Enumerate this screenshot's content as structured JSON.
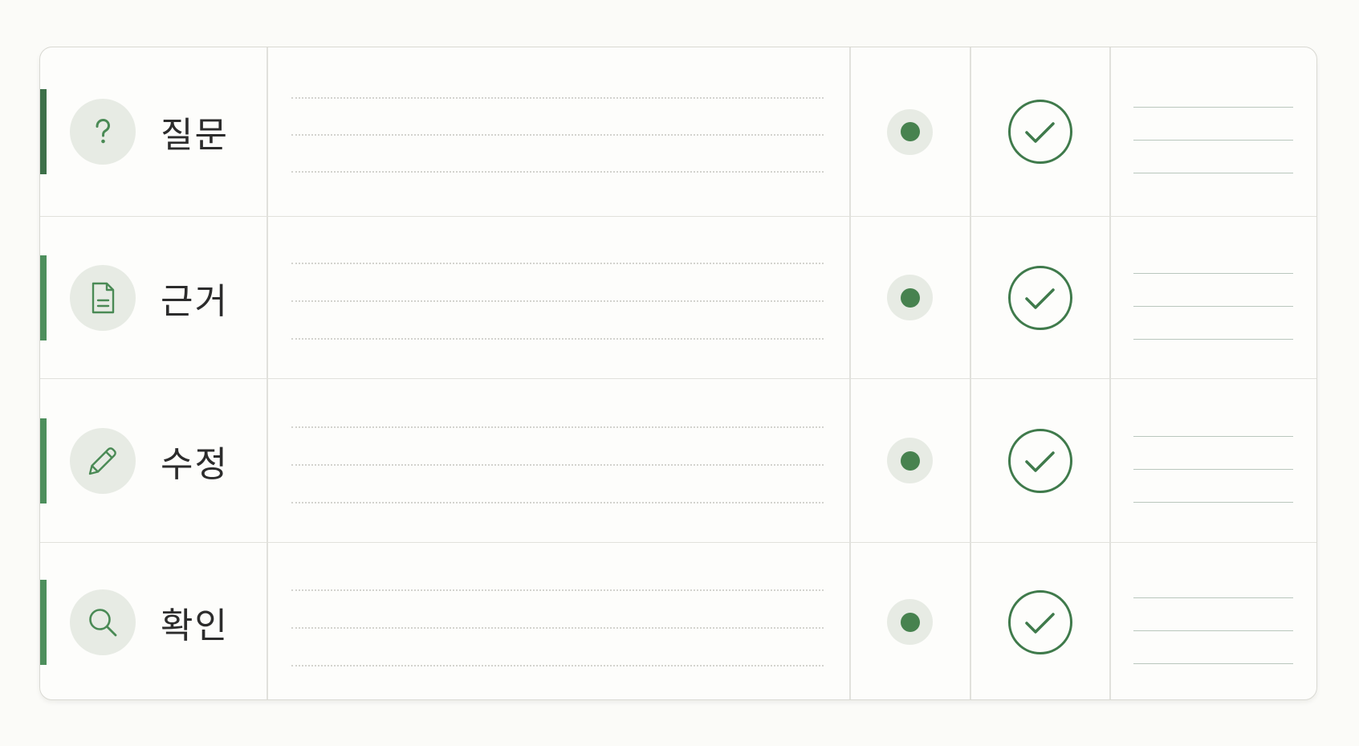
{
  "colors": {
    "accent": "#3e7a4c",
    "icon_green": "#4a8a55",
    "status_dot": "#47824f",
    "soft_bg": "#e7ebe4"
  },
  "rows": [
    {
      "label": "질문",
      "icon": "question-mark-icon",
      "accent_color": "#3d7049"
    },
    {
      "label": "근거",
      "icon": "document-icon",
      "accent_color": "#4d8f5c"
    },
    {
      "label": "수정",
      "icon": "pencil-icon",
      "accent_color": "#4d8f5c"
    },
    {
      "label": "확인",
      "icon": "magnifier-icon",
      "accent_color": "#4d8f5c"
    }
  ]
}
